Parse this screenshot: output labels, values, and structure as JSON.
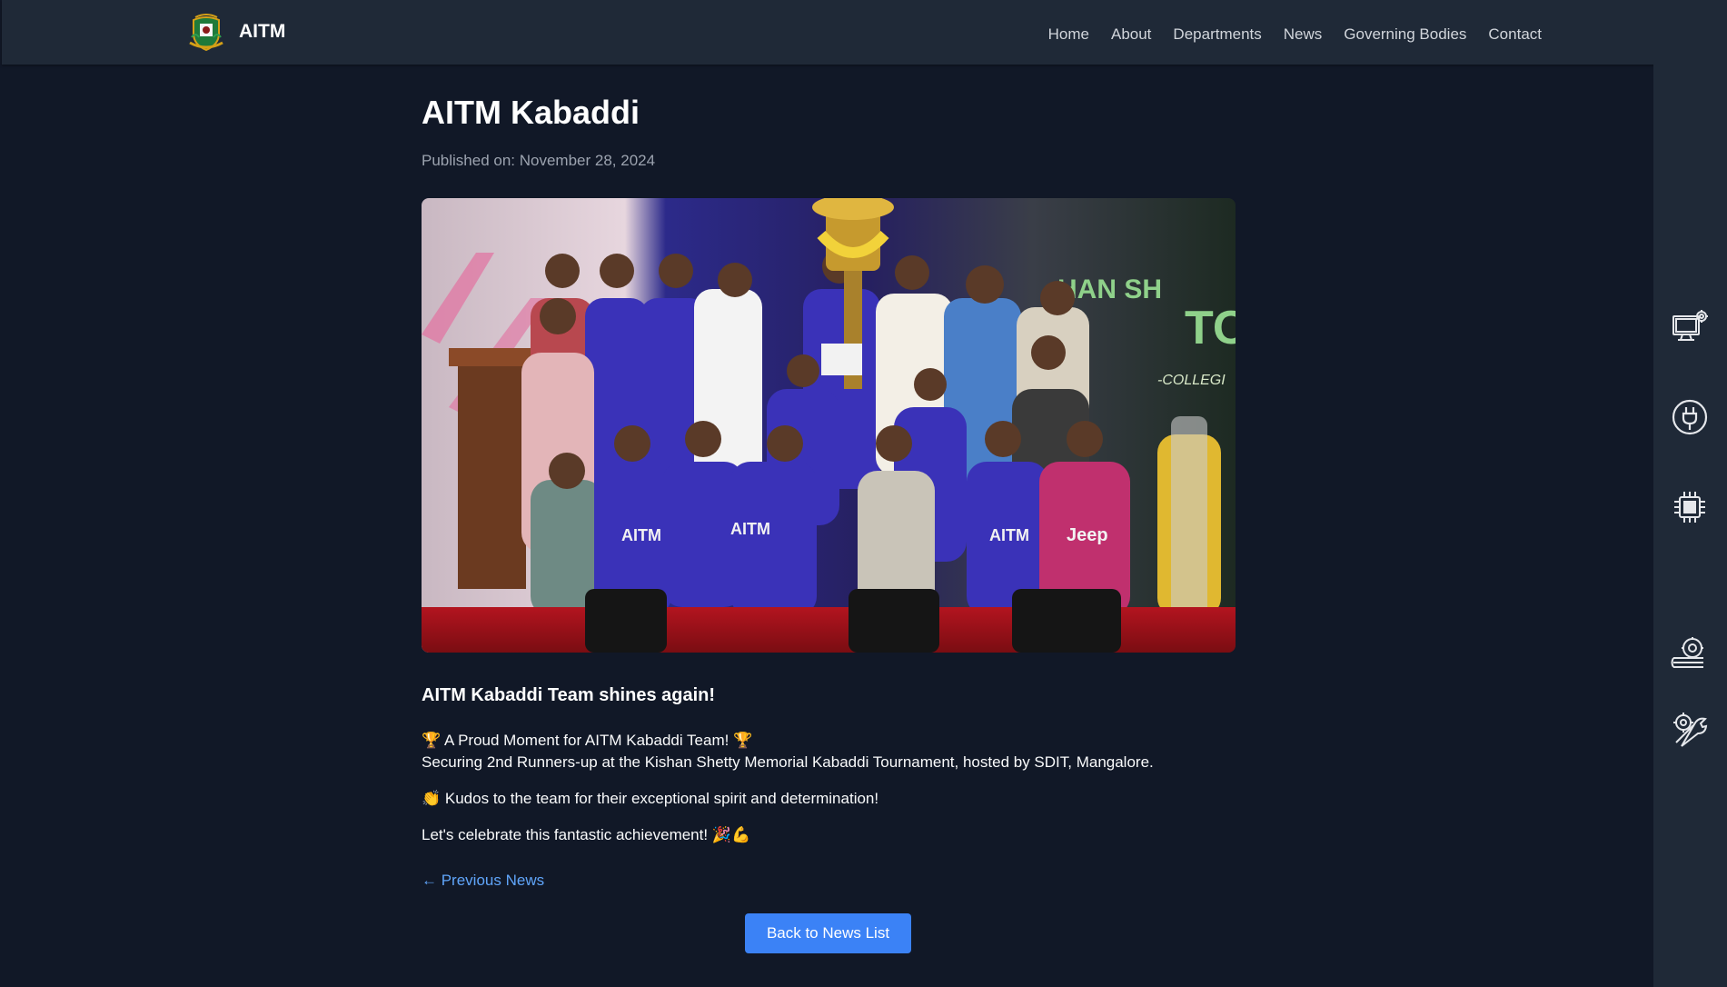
{
  "nav": {
    "brand": "AITM",
    "links": [
      "Home",
      "About",
      "Departments",
      "News",
      "Governing Bodies",
      "Contact"
    ]
  },
  "article": {
    "title": "AITM Kabaddi",
    "published": "Published on: November 28, 2024",
    "subtitle": "AITM Kabaddi Team shines again!",
    "line1": "🏆 A Proud Moment for AITM Kabaddi Team! 🏆",
    "line2": "Securing 2nd Runners-up at the Kishan Shetty Memorial Kabaddi Tournament, hosted by SDIT, Mangalore.",
    "line3": "👏 Kudos to the team for their exceptional spirit and determination!",
    "line4": "Let's celebrate this fantastic achievement! 🎉💪",
    "prev_link": "← Previous News",
    "back_button": "Back to News List"
  },
  "photo": {
    "banner_text": "HAN SH",
    "banner_text2": "TO",
    "banner_text3": "-COLLEGI",
    "jersey_text": "AITM",
    "jeep_text": "Jeep"
  },
  "rail": {
    "icons": [
      "computer-gear-icon",
      "plug-icon",
      "chip-icon",
      "engine-icon",
      "tools-icon"
    ]
  },
  "colors": {
    "page_bg": "#111827",
    "nav_bg": "#1f2937",
    "accent": "#3b82f6",
    "link": "#60a5fa"
  }
}
